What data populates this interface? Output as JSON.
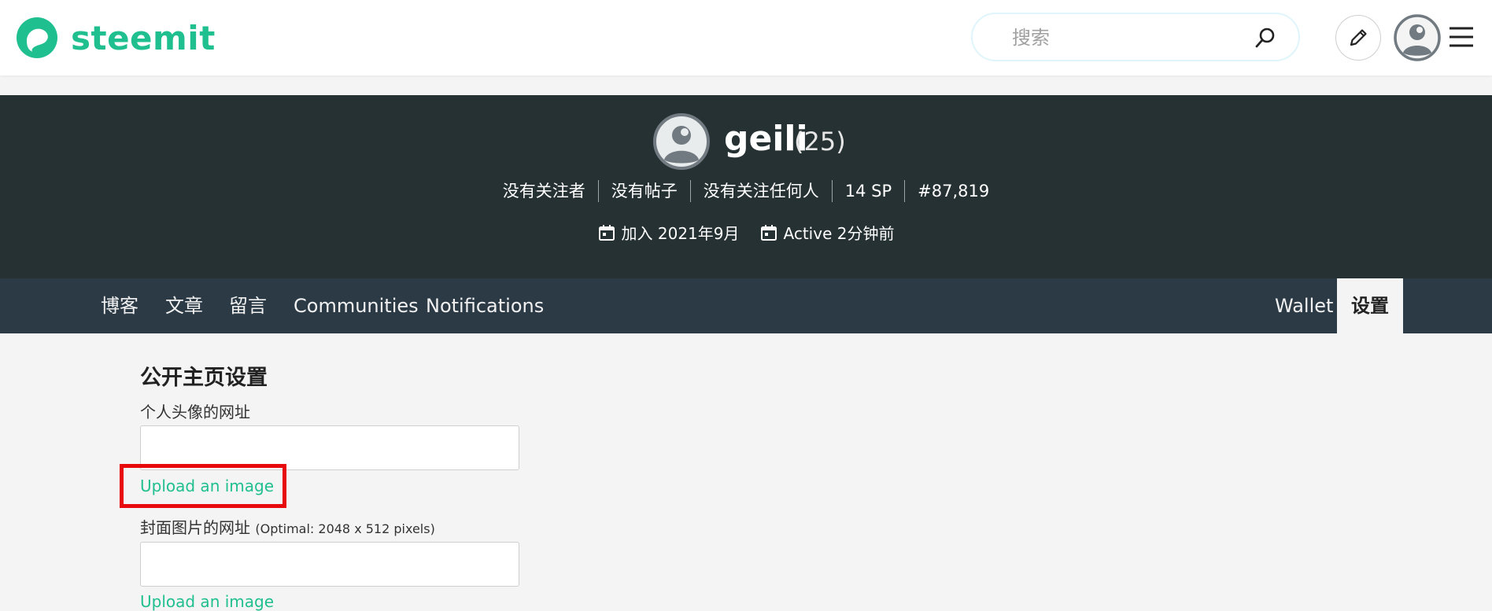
{
  "header": {
    "brand": "steemit",
    "brand_color": "#1fbf8f",
    "search_placeholder": "搜索",
    "icons": [
      "steemit-logo-icon",
      "search-icon",
      "pencil-icon",
      "user-avatar-icon",
      "hamburger-menu-icon"
    ]
  },
  "profile": {
    "username": "geili",
    "reputation": "(25)",
    "stats": [
      "没有关注者",
      "没有帖子",
      "没有关注任何人",
      "14 SP",
      "#87,819"
    ],
    "joined": "加入 2021年9月",
    "active": "Active 2分钟前"
  },
  "tabs": {
    "left": [
      "博客",
      "文章",
      "留言",
      "Communities",
      "Notifications"
    ],
    "right": [
      "Wallet",
      "设置"
    ],
    "active": "设置"
  },
  "settings": {
    "section_title": "公开主页设置",
    "avatar_label": "个人头像的网址",
    "avatar_value": "",
    "upload_label": "Upload an image",
    "cover_label": "封面图片的网址",
    "cover_hint": "(Optimal: 2048 x 512 pixels)",
    "cover_value": "",
    "upload_label_2": "Upload an image"
  },
  "colors": {
    "banner": "#263133",
    "tabs_bar": "#2c3a46",
    "link": "#1fbf8f",
    "highlight": "#e8090c"
  }
}
